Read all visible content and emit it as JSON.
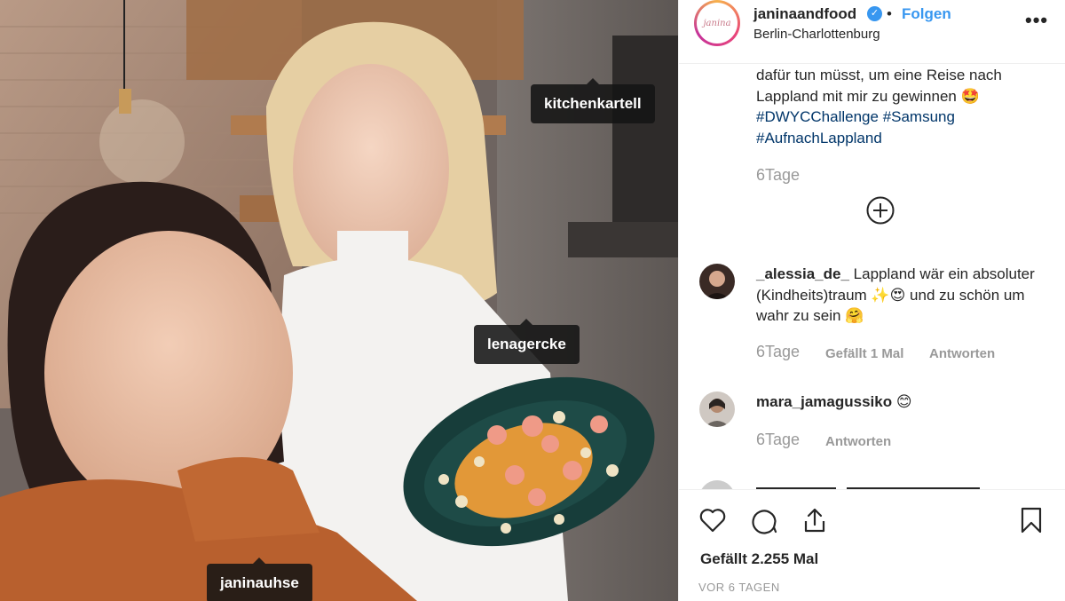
{
  "photo": {
    "tags": {
      "kitchen": "kitchenkartell",
      "lena": "lenagercke",
      "janina": "janinauhse"
    }
  },
  "header": {
    "avatar_text": "janina",
    "username": "janinaandfood",
    "separator": "•",
    "follow_label": "Folgen",
    "location": "Berlin-Charlottenburg",
    "more_label": "•••"
  },
  "caption": {
    "text_line1": "dafür tun müsst, um eine Reise nach",
    "text_line2": "Lappland mit mir zu gewinnen 🤩",
    "hashtag1": "#DWYCChallenge",
    "hashtag2": "#Samsung",
    "hashtag3": "#AufnachLappland",
    "time": "6Tage"
  },
  "comments": [
    {
      "user": "_alessia_de_",
      "text": "Lappland wär ein absoluter (Kindheits)traum ✨😍 und zu schön um wahr zu sein 🤗",
      "time": "6Tage",
      "likes": "Gefällt 1 Mal",
      "reply": "Antworten"
    },
    {
      "user": "mara_jamagussiko",
      "text": "😊",
      "time": "6Tage",
      "reply": "Antworten"
    }
  ],
  "footer": {
    "likes": "Gefällt 2.255 Mal",
    "ago": "VOR 6 TAGEN"
  },
  "colors": {
    "link": "#3897f0",
    "hashtag": "#003569",
    "muted": "#999999",
    "verified": "#3897f0"
  },
  "icons": [
    "heart-icon",
    "comment-icon",
    "share-icon",
    "bookmark-icon",
    "plus-circle-icon",
    "verified-icon",
    "more-icon"
  ]
}
